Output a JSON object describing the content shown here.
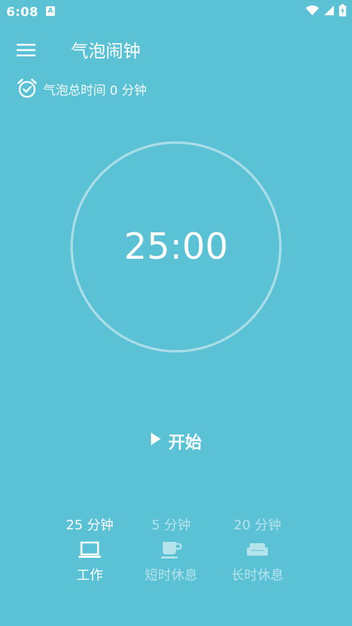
{
  "status_bar": {
    "time": "6:08",
    "notification_glyph": "A",
    "icons": [
      "wifi-icon",
      "cellular-signal-icon",
      "battery-charging-icon"
    ]
  },
  "app_bar": {
    "title": "气泡闹钟",
    "menu_icon": "menu-icon"
  },
  "summary": {
    "total_text": "气泡总时间 0 分钟",
    "icon": "alarm-clock-check-icon"
  },
  "timer": {
    "display": "25:00",
    "progress": 0
  },
  "controls": {
    "start_label": "开始",
    "start_icon": "play-icon"
  },
  "modes": [
    {
      "duration": "25 分钟",
      "label": "工作",
      "icon": "laptop-icon",
      "active": true
    },
    {
      "duration": "5 分钟",
      "label": "短时休息",
      "icon": "coffee-cup-icon",
      "active": false
    },
    {
      "duration": "20 分钟",
      "label": "长时休息",
      "icon": "sofa-icon",
      "active": false
    }
  ],
  "colors": {
    "background": "#5BC2D6",
    "foreground": "#FFFFFF",
    "ring": "#A9DDE8",
    "inactive": "rgba(255,255,255,0.55)"
  }
}
